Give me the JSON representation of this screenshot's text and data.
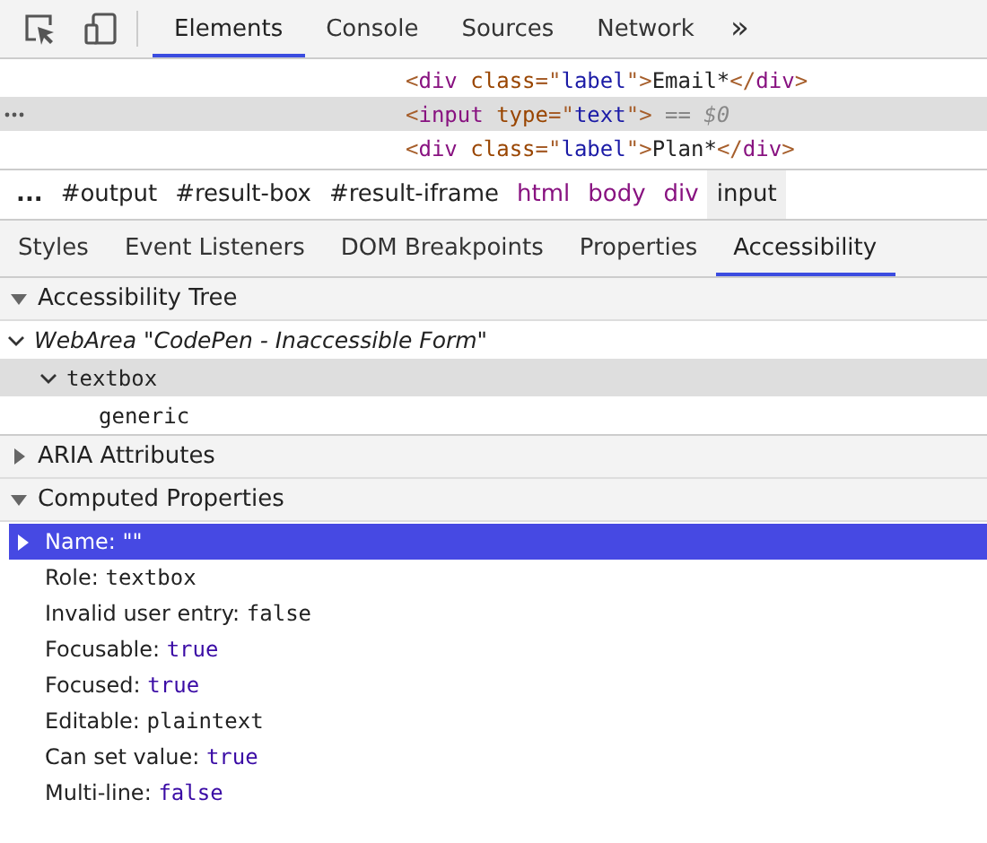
{
  "toolbar": {
    "tabs": [
      {
        "label": "Elements",
        "selected": true
      },
      {
        "label": "Console",
        "selected": false
      },
      {
        "label": "Sources",
        "selected": false
      },
      {
        "label": "Network",
        "selected": false
      }
    ],
    "overflow": "»"
  },
  "dom_lines": [
    {
      "selected": false,
      "tokens": [
        {
          "kind": "punct",
          "text": "<"
        },
        {
          "kind": "tag",
          "text": "div"
        },
        {
          "kind": "attr",
          "text": " class"
        },
        {
          "kind": "punct",
          "text": "=\""
        },
        {
          "kind": "value",
          "text": "label"
        },
        {
          "kind": "punct",
          "text": "\">"
        },
        {
          "kind": "text",
          "text": "Email*"
        },
        {
          "kind": "punct",
          "text": "</"
        },
        {
          "kind": "tag",
          "text": "div"
        },
        {
          "kind": "punct",
          "text": ">"
        }
      ]
    },
    {
      "selected": true,
      "tokens": [
        {
          "kind": "punct",
          "text": "<"
        },
        {
          "kind": "tag",
          "text": "input"
        },
        {
          "kind": "attr",
          "text": " type"
        },
        {
          "kind": "punct",
          "text": "=\""
        },
        {
          "kind": "value",
          "text": "text"
        },
        {
          "kind": "punct",
          "text": "\">"
        },
        {
          "kind": "comment",
          "text": " == $0"
        }
      ]
    },
    {
      "selected": false,
      "tokens": [
        {
          "kind": "punct",
          "text": "<"
        },
        {
          "kind": "tag",
          "text": "div"
        },
        {
          "kind": "attr",
          "text": " class"
        },
        {
          "kind": "punct",
          "text": "=\""
        },
        {
          "kind": "value",
          "text": "label"
        },
        {
          "kind": "punct",
          "text": "\">"
        },
        {
          "kind": "text",
          "text": "Plan*"
        },
        {
          "kind": "punct",
          "text": "</"
        },
        {
          "kind": "tag",
          "text": "div"
        },
        {
          "kind": "punct",
          "text": ">"
        }
      ]
    }
  ],
  "breadcrumbs": [
    {
      "kind": "more",
      "text": "...",
      "selected": false
    },
    {
      "kind": "id",
      "text": "#output",
      "selected": false
    },
    {
      "kind": "id",
      "text": "#result-box",
      "selected": false
    },
    {
      "kind": "id",
      "text": "#result-iframe",
      "selected": false
    },
    {
      "kind": "tag",
      "text": "html",
      "selected": false
    },
    {
      "kind": "tag",
      "text": "body",
      "selected": false
    },
    {
      "kind": "tag",
      "text": "div",
      "selected": false
    },
    {
      "kind": "tag",
      "text": "input",
      "selected": true
    }
  ],
  "sub_tabs": [
    {
      "label": "Styles",
      "selected": false
    },
    {
      "label": "Event Listeners",
      "selected": false
    },
    {
      "label": "DOM Breakpoints",
      "selected": false
    },
    {
      "label": "Properties",
      "selected": false
    },
    {
      "label": "Accessibility",
      "selected": true
    }
  ],
  "sections": [
    {
      "title": "Accessibility Tree",
      "expanded": true,
      "kind": "tree",
      "tree": [
        {
          "role": "WebArea",
          "name": "\"CodePen - Inaccessible Form\"",
          "expanded": true,
          "selected": false,
          "children": [
            {
              "role": "textbox",
              "expanded": true,
              "selected": true,
              "children": [
                {
                  "role": "generic",
                  "selected": false
                }
              ]
            }
          ]
        }
      ]
    },
    {
      "title": "ARIA Attributes",
      "expanded": false
    },
    {
      "title": "Computed Properties",
      "expanded": true,
      "kind": "props",
      "properties": [
        {
          "label": "Name:",
          "value": "\"\"",
          "kind": "string",
          "selected": true,
          "expandable": true
        },
        {
          "label": "Role:",
          "value": "textbox",
          "kind": "token",
          "selected": false,
          "expandable": false
        },
        {
          "label": "Invalid user entry:",
          "value": "false",
          "kind": "token",
          "selected": false,
          "expandable": false
        },
        {
          "label": "Focusable:",
          "value": "true",
          "kind": "boolean",
          "selected": false,
          "expandable": false
        },
        {
          "label": "Focused:",
          "value": "true",
          "kind": "boolean",
          "selected": false,
          "expandable": false
        },
        {
          "label": "Editable:",
          "value": "plaintext",
          "kind": "token",
          "selected": false,
          "expandable": false
        },
        {
          "label": "Can set value:",
          "value": "true",
          "kind": "boolean",
          "selected": false,
          "expandable": false
        },
        {
          "label": "Multi-line:",
          "value": "false",
          "kind": "boolean",
          "selected": false,
          "expandable": false
        }
      ]
    }
  ]
}
